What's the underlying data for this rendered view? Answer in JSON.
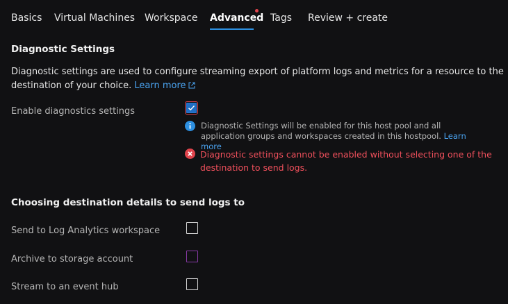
{
  "tabs": [
    {
      "label": "Basics"
    },
    {
      "label": "Virtual Machines"
    },
    {
      "label": "Workspace"
    },
    {
      "label": "Advanced",
      "active": true
    },
    {
      "label": "Tags"
    },
    {
      "label": "Review + create"
    }
  ],
  "diagnostic": {
    "title": "Diagnostic Settings",
    "description": "Diagnostic settings are used to configure streaming export of platform logs and metrics for a resource to the destination of your choice.",
    "learn_more": "Learn more",
    "enable_label": "Enable diagnostics settings",
    "enable_checked": true,
    "info_text": "Diagnostic Settings will be enabled for this host pool and all application groups and workspaces created in this hostpool.",
    "info_link": "Learn more",
    "error_text": "Diagnostic settings cannot be enabled without selecting one of the destination to send logs."
  },
  "destinations": {
    "title": "Choosing destination details to send logs to",
    "items": [
      {
        "label": "Send to Log Analytics workspace",
        "checked": false
      },
      {
        "label": "Archive to storage account",
        "checked": false
      },
      {
        "label": "Stream to an event hub",
        "checked": false
      }
    ]
  },
  "colors": {
    "accent": "#2d8fe0",
    "link": "#4aa3f0",
    "error": "#f0505c",
    "background": "#111113"
  },
  "icons": {
    "info": "info-circle-icon",
    "error": "error-circle-icon",
    "external_link": "external-link-icon",
    "check": "checkmark-icon"
  }
}
